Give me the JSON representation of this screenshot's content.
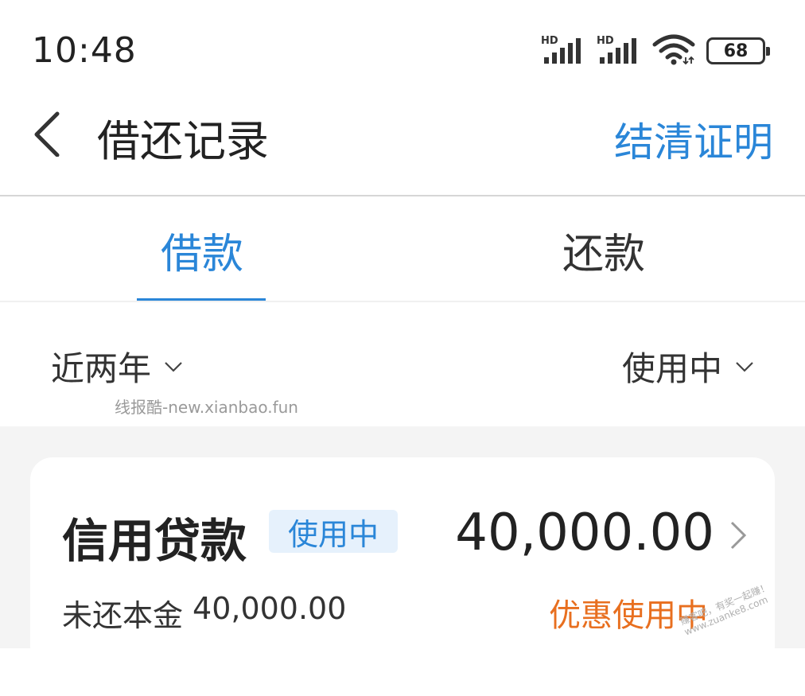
{
  "status_bar": {
    "time": "10:48",
    "battery": "68",
    "signal_1_label": "HD",
    "signal_2_label": "HD",
    "icons": [
      "hd-signal-icon",
      "hd-signal-icon",
      "wifi-icon",
      "battery-icon"
    ]
  },
  "nav": {
    "title": "借还记录",
    "settle_proof": "结清证明",
    "back_icon": "chevron-left-icon"
  },
  "tabs": [
    {
      "label": "借款",
      "active": true
    },
    {
      "label": "还款",
      "active": false
    }
  ],
  "filters": {
    "period": "近两年",
    "status": "使用中"
  },
  "watermark": "线报酷-new.xianbao.fun",
  "loan": {
    "name": "信用贷款",
    "status": "使用中",
    "amount": "40,000.00",
    "principal_label": "未还本金",
    "principal_value": "40,000.00",
    "promo": "优惠使用中"
  },
  "corner_watermark_1": "赚客吧，有奖一起赚！",
  "corner_watermark_2": "www.zuanke8.com",
  "colors": {
    "accent": "#2a86d8",
    "promo": "#e86f1f",
    "badge_bg": "#e6f1fc",
    "page_bg": "#f4f4f4"
  }
}
